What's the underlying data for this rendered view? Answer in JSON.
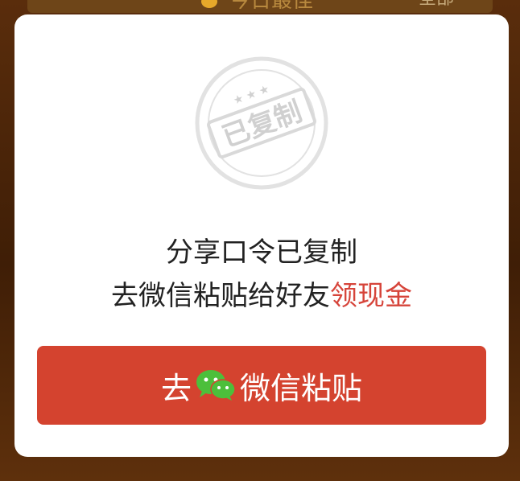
{
  "background": {
    "top_text": "今日最佳",
    "top_right_text": "全部"
  },
  "dialog": {
    "stamp_text": "已复制",
    "message_line1": "分享口令已复制",
    "message_line2_prefix": "去微信粘贴给好友",
    "message_line2_highlight": "领现金",
    "button_prefix": "去",
    "button_icon": "wechat-icon",
    "button_suffix": "微信粘贴"
  },
  "colors": {
    "accent_red": "#d4432f",
    "highlight_red": "#d6443a",
    "wechat_green": "#4cbf3b"
  }
}
